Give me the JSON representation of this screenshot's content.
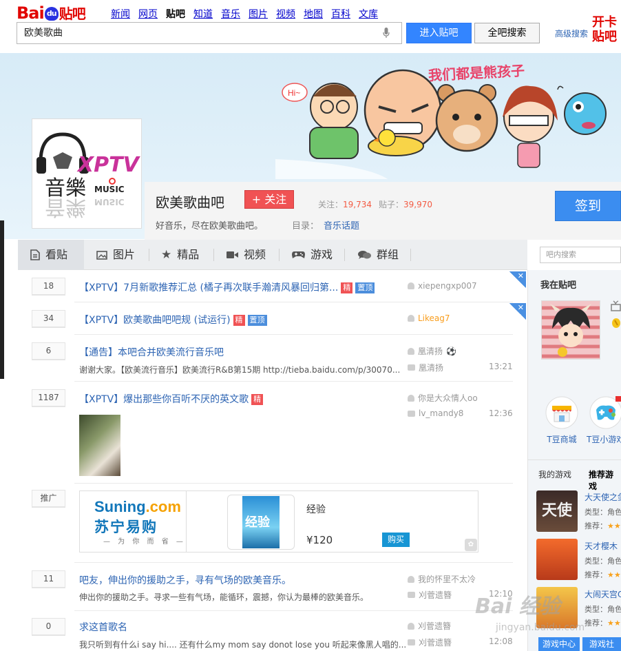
{
  "logo": {
    "brand_a": "Bai",
    "brand_paw": "du",
    "brand_b": "贴吧"
  },
  "nav": {
    "items": [
      "新闻",
      "网页",
      "贴吧",
      "知道",
      "音乐",
      "图片",
      "视频",
      "地图",
      "百科",
      "文库"
    ],
    "current": "贴吧"
  },
  "search": {
    "value": "欧美歌曲",
    "enter_label": "进入贴吧",
    "all_label": "全吧搜索",
    "advanced": "高级搜索"
  },
  "promo_corner": "开卡\n贴吧",
  "banner": {
    "slogan": "我们都是熊孩子",
    "hi_bubble": "Hi~"
  },
  "forum": {
    "logo_text_1": "XPTV",
    "logo_text_2": "音樂",
    "logo_text_3": "MUSIC",
    "name": "欧美歌曲吧",
    "follow_label": "+ 关注",
    "follow_count_label": "关注：",
    "follow_count": "19,734",
    "post_count_label": "贴子：",
    "post_count": "39,970",
    "description": "好音乐，尽在欧美歌曲吧。",
    "directory_label": "目录：",
    "directory": "音乐话题",
    "signin_label": "签到"
  },
  "tabs": [
    {
      "label": "看贴",
      "icon": "document-icon"
    },
    {
      "label": "图片",
      "icon": "image-icon"
    },
    {
      "label": "精品",
      "icon": "star-icon"
    },
    {
      "label": "视频",
      "icon": "video-icon"
    },
    {
      "label": "游戏",
      "icon": "gamepad-icon"
    },
    {
      "label": "群组",
      "icon": "chat-icon"
    }
  ],
  "forum_search_placeholder": "吧内搜索",
  "threads": [
    {
      "replies": "18",
      "title": "【XPTV】7月新歌推荐汇总 (橘子再次联手瀚清风暴回归第...",
      "author": "xiepengxp007"
    },
    {
      "replies": "34",
      "title": "【XPTV】欧美歌曲吧吧规 (试运行)",
      "author": "Likeag7"
    },
    {
      "replies": "6",
      "title": "【通告】本吧合并欧美流行音乐吧",
      "snippet": "谢谢大家。【欧美流行音乐】欧美流行R&B第15期 http://tieba.baidu.com/p/30070...",
      "author": "凰清扬",
      "last_reply": "凰清扬",
      "time": "13:21"
    },
    {
      "replies": "1187",
      "title": "【XPTV】爆出那些你百听不厌的英文歌",
      "author": "你是大众情人oo",
      "last_reply": "lv_mandy8",
      "time": "12:36"
    },
    {
      "replies": "11",
      "title": "吧友，伸出你的援助之手，寻有气场的欧美音乐。",
      "snippet": "伸出你的援助之手。寻求一些有气场，能循环，震撼，你认为最棒的欧美音乐。",
      "author": "我的怀里不太冷",
      "last_reply": "刈菅遗簪",
      "time": "12:10"
    },
    {
      "replies": "0",
      "title": "求这首歌名",
      "snippet": "我只听到有什么i say hi.... 还有什么my mom say donot lose you 听起来像黑人唱的...",
      "author": "刈菅遗簪",
      "last_reply": "刈菅遗簪",
      "time": "12:08"
    }
  ],
  "badges": {
    "jing": "精",
    "top": "置顶"
  },
  "ad": {
    "label": "推广",
    "brand_1": "Suning",
    "brand_dot": ".com",
    "brand_2": "苏宁易购",
    "brand_3": "— 为 你 而 省 —",
    "book_cover": "经验",
    "title": "经验",
    "price": "¥120",
    "buy": "购买"
  },
  "sidebar": {
    "my_in_bar": "我在贴吧",
    "apps": [
      "T豆商城",
      "T豆小游戏"
    ],
    "games_tab": "我的游戏",
    "rec_tab": "推荐游戏",
    "games": [
      {
        "name": "大天使之剑",
        "type": "类型：角色",
        "rec": "推荐：",
        "stars": "★★"
      },
      {
        "name": "天才樱木",
        "type": "类型：角色",
        "rec": "推荐：",
        "stars": "★★"
      },
      {
        "name": "大闹天宫OL",
        "type": "类型：角色",
        "rec": "推荐：",
        "stars": "★★"
      }
    ],
    "game_thumb_1": "天使",
    "btn_center": "游戏中心",
    "btn_more": "游戏社"
  },
  "watermark": {
    "main": "Bai 经验",
    "sub": "jingyan.baidu.com"
  },
  "colors": {
    "accent": "#3385ff",
    "brand_red": "#e10602",
    "link": "#2d64b3",
    "badge_red": "#f05254"
  }
}
